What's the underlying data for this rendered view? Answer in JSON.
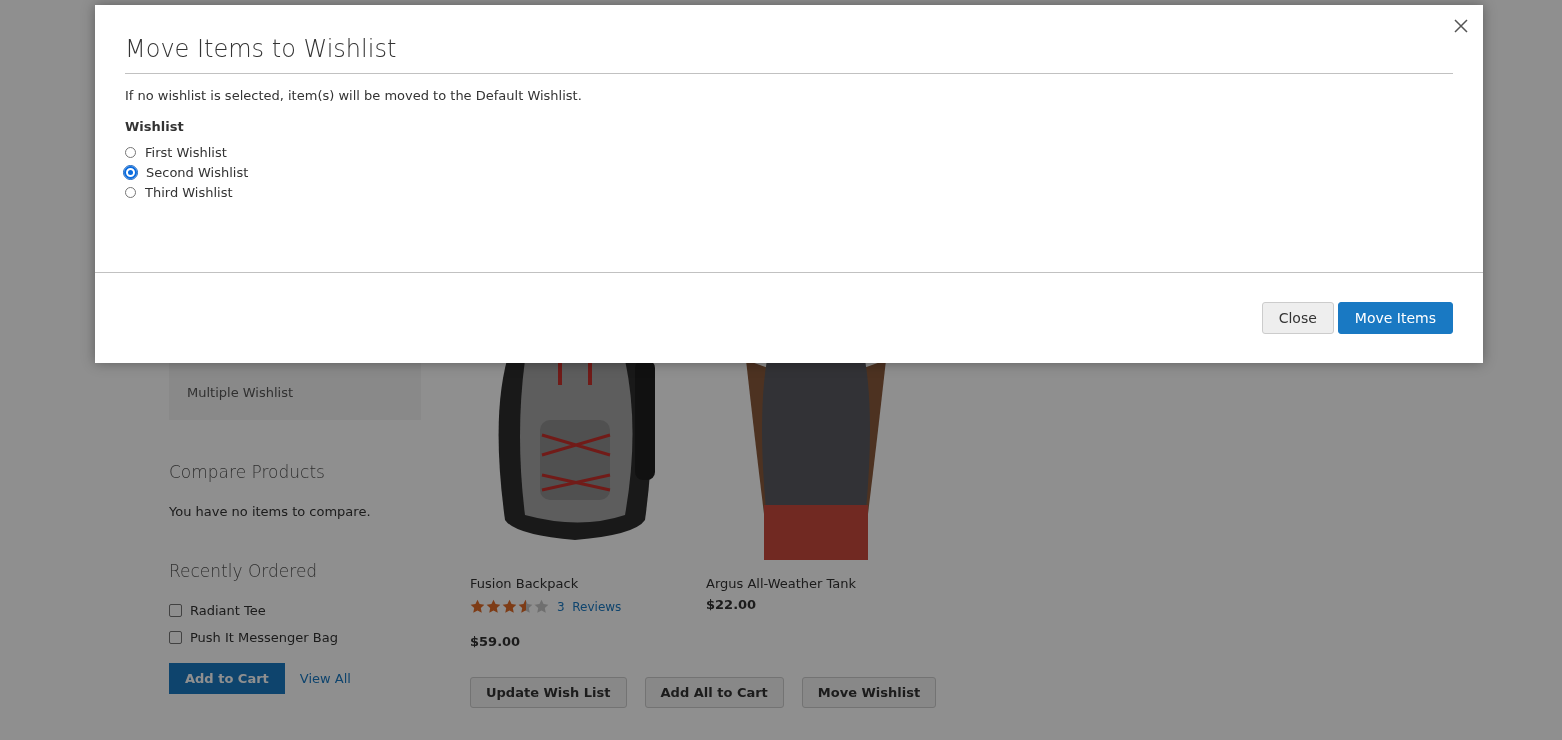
{
  "sidebar": {
    "account_links": [
      {
        "label": "Multiple Wishlist"
      }
    ],
    "compare": {
      "title": "Compare Products",
      "message": "You have no items to compare."
    },
    "recently_ordered": {
      "title": "Recently Ordered",
      "items": [
        {
          "label": "Radiant Tee",
          "checked": false
        },
        {
          "label": "Push It Messenger Bag",
          "checked": false
        }
      ],
      "add_button": "Add to Cart",
      "view_all": "View All"
    }
  },
  "products": [
    {
      "kind": "backpack",
      "name": "Fusion Backpack",
      "stars": 3.5,
      "reviews_count": "3",
      "reviews_label": "Reviews",
      "price": "$59.00"
    },
    {
      "kind": "tank",
      "name": "Argus All-Weather Tank",
      "price": "$22.00"
    }
  ],
  "wishlist_actions": [
    "Update Wish List",
    "Add All to Cart",
    "Move Wishlist"
  ],
  "modal": {
    "title": "Move Items to Wishlist",
    "note": "If no wishlist is selected, item(s) will be moved to the Default Wishlist.",
    "field_label": "Wishlist",
    "options": [
      {
        "label": "First Wishlist",
        "selected": false
      },
      {
        "label": "Second Wishlist",
        "selected": true
      },
      {
        "label": "Third Wishlist",
        "selected": false
      }
    ],
    "buttons": [
      {
        "label": "Close",
        "kind": "secondary"
      },
      {
        "label": "Move Items",
        "kind": "primary"
      }
    ]
  }
}
